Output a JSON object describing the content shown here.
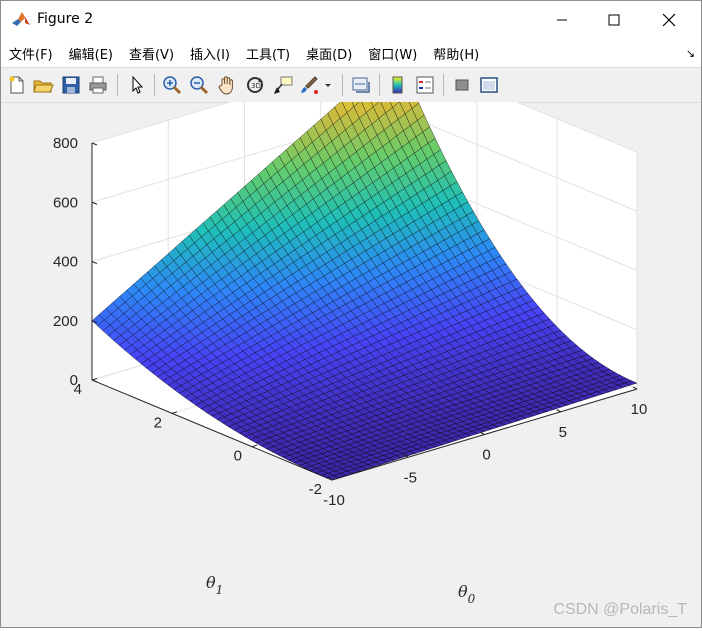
{
  "window": {
    "title": "Figure 2",
    "controls": [
      "minimize-icon",
      "maximize-icon",
      "close-icon"
    ]
  },
  "menubar": {
    "items": [
      {
        "label": "文件(F)"
      },
      {
        "label": "编辑(E)"
      },
      {
        "label": "查看(V)"
      },
      {
        "label": "插入(I)"
      },
      {
        "label": "工具(T)"
      },
      {
        "label": "桌面(D)"
      },
      {
        "label": "窗口(W)"
      },
      {
        "label": "帮助(H)"
      }
    ],
    "corner_icon": "dock-arrow-icon"
  },
  "toolbar": {
    "icons": [
      "new-figure-icon",
      "open-file-icon",
      "save-icon",
      "print-icon",
      "select-pointer-icon",
      "zoom-in-icon",
      "zoom-out-icon",
      "pan-hand-icon",
      "rotate-3d-icon",
      "data-cursor-icon",
      "brush-icon",
      "brush-dropdown-icon",
      "link-plot-icon",
      "colorbar-icon",
      "legend-icon",
      "hide-plot-tools-icon",
      "show-plot-tools-icon"
    ]
  },
  "colors": {
    "colormap": [
      "#3e26a8",
      "#4743f6",
      "#2e87f7",
      "#1fbfb8",
      "#64cc6c",
      "#d3bb3c",
      "#f9fb15"
    ],
    "mesh_edges": "#000000",
    "grid": "#e2e2e2"
  },
  "chart_data": {
    "type": "surface",
    "title": "",
    "xlabel": "θ0",
    "ylabel": "θ1",
    "zlabel": "",
    "xlim": [
      -10,
      10
    ],
    "ylim": [
      -2,
      4
    ],
    "zlim": [
      0,
      800
    ],
    "xticks": [
      "-10",
      "-5",
      "0",
      "5",
      "10"
    ],
    "yticks": [
      "-2",
      "0",
      "2",
      "4"
    ],
    "zticks": [
      "0",
      "200",
      "400",
      "600",
      "800"
    ],
    "x_label": {
      "main": "θ",
      "sub": "0"
    },
    "y_label": {
      "main": "θ",
      "sub": "1"
    },
    "corner_values": [
      {
        "x": -10,
        "y": -2,
        "z": 0
      },
      {
        "x": 10,
        "y": -2,
        "z": 20
      },
      {
        "x": -10,
        "y": 4,
        "z": 200
      },
      {
        "x": 10,
        "y": 4,
        "z": 800
      }
    ],
    "grid": true,
    "view": "3d-default"
  },
  "watermark": "CSDN @Polaris_T"
}
